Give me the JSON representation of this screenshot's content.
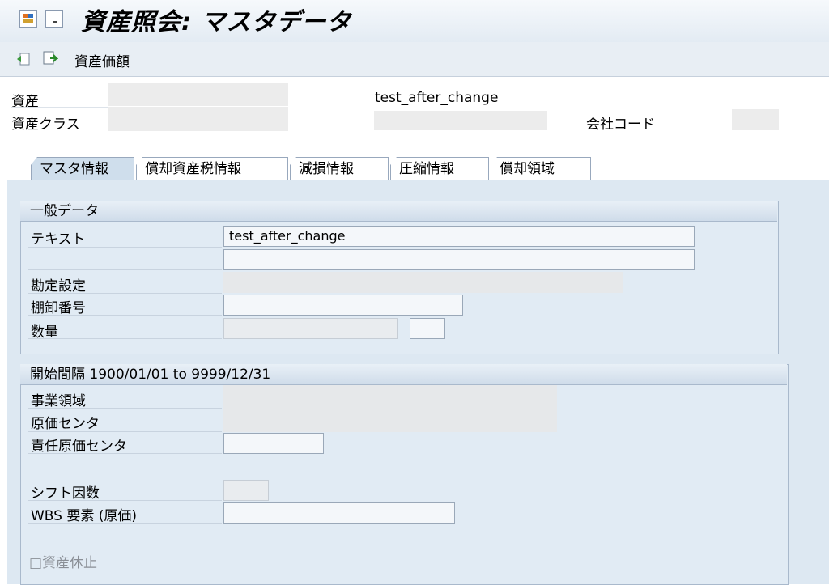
{
  "title": "資産照会: マスタデータ",
  "toolbar": {
    "button_label": "資産価額"
  },
  "header": {
    "asset_label": "資産",
    "asset_text": "test_after_change",
    "asset_class_label": "資産クラス",
    "company_code_label": "会社コード"
  },
  "tabs": [
    {
      "label": "マスタ情報",
      "active": true
    },
    {
      "label": "償却資産税情報",
      "active": false
    },
    {
      "label": "減損情報",
      "active": false
    },
    {
      "label": "圧縮情報",
      "active": false
    },
    {
      "label": "償却領域",
      "active": false
    }
  ],
  "general": {
    "heading": "一般データ",
    "text_label": "テキスト",
    "text_value": "test_after_change",
    "text2_value": "",
    "account_label": "勘定設定",
    "inventory_label": "棚卸番号",
    "inventory_value": "",
    "quantity_label": "数量"
  },
  "interval": {
    "heading": "開始間隔 1900/01/01 to 9999/12/31",
    "business_area_label": "事業領域",
    "cost_center_label": "原価センタ",
    "resp_cost_center_label": "責任原価センタ",
    "shift_factor_label": "シフト因数",
    "wbs_label": "WBS 要素 (原価)",
    "inactive_label": "□資産休止"
  }
}
